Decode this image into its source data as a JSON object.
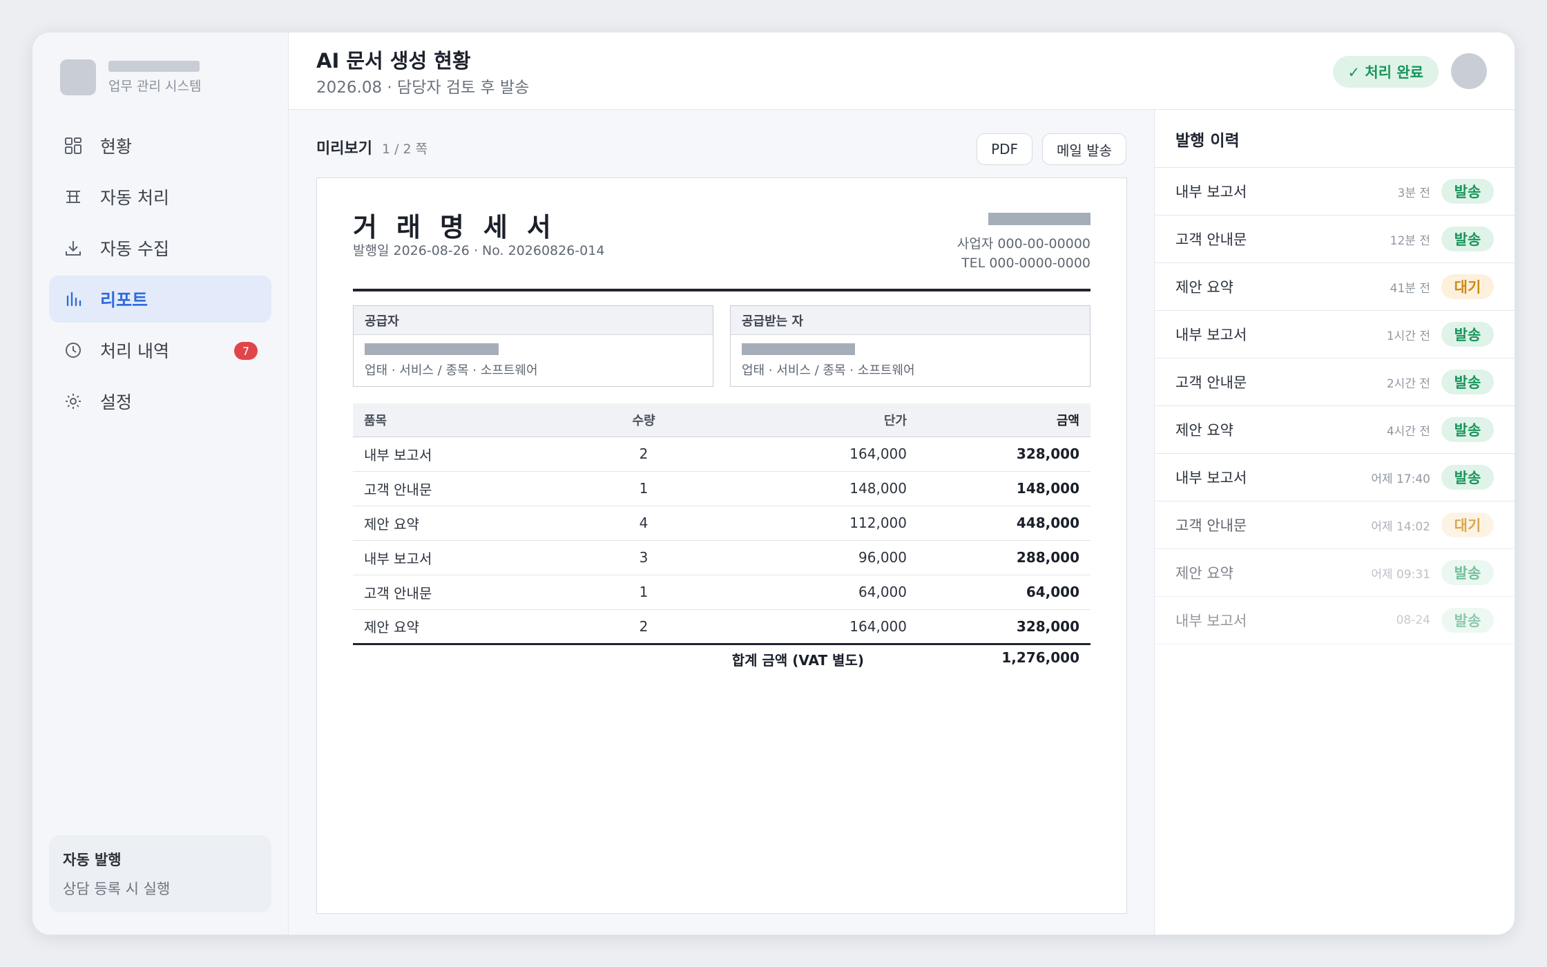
{
  "brand": {
    "subtitle": "업무 관리 시스템"
  },
  "nav": {
    "items": [
      {
        "label": "현황",
        "icon": "dashboard-grid-icon"
      },
      {
        "label": "자동 처리",
        "icon": "table-icon"
      },
      {
        "label": "자동 수집",
        "icon": "download-icon"
      },
      {
        "label": "리포트",
        "icon": "bar-chart-icon",
        "active": true
      },
      {
        "label": "처리 내역",
        "icon": "clock-icon",
        "badge": "7"
      },
      {
        "label": "설정",
        "icon": "gear-icon"
      }
    ]
  },
  "auto_card": {
    "title": "자동 발행",
    "subtitle": "상담 등록 시 실행"
  },
  "header": {
    "title": "AI 문서 생성 현황",
    "subtitle": "2026.08 · 담당자 검토 후 발송",
    "status": "✓ 처리 완료"
  },
  "preview": {
    "label": "미리보기",
    "page_info": "1 / 2 쪽",
    "pdf_button": "PDF",
    "mail_button": "메일 발송"
  },
  "document": {
    "title": "거래명세서",
    "meta": "발행일 2026-08-26 · No. 20260826-014",
    "biz_no": "사업자 000-00-00000",
    "tel": "TEL 000-0000-0000",
    "supplier": {
      "label": "공급자",
      "desc": "업태 · 서비스 / 종목 · 소프트웨어"
    },
    "receiver": {
      "label": "공급받는 자",
      "desc": "업태 · 서비스 / 종목 · 소프트웨어"
    },
    "columns": {
      "name": "품목",
      "qty": "수량",
      "price": "단가",
      "amount": "금액"
    },
    "rows": [
      {
        "name": "내부 보고서",
        "qty": "2",
        "price": "164,000",
        "amount": "328,000"
      },
      {
        "name": "고객 안내문",
        "qty": "1",
        "price": "148,000",
        "amount": "148,000"
      },
      {
        "name": "제안 요약",
        "qty": "4",
        "price": "112,000",
        "amount": "448,000"
      },
      {
        "name": "내부 보고서",
        "qty": "3",
        "price": "96,000",
        "amount": "288,000"
      },
      {
        "name": "고객 안내문",
        "qty": "1",
        "price": "64,000",
        "amount": "64,000"
      },
      {
        "name": "제안 요약",
        "qty": "2",
        "price": "164,000",
        "amount": "328,000"
      }
    ],
    "total_label": "합계 금액 (VAT 별도)",
    "total_value": "1,276,000"
  },
  "history": {
    "title": "발행 이력",
    "items": [
      {
        "name": "내부 보고서",
        "time": "3분 전",
        "status": "발송"
      },
      {
        "name": "고객 안내문",
        "time": "12분 전",
        "status": "발송"
      },
      {
        "name": "제안 요약",
        "time": "41분 전",
        "status": "대기"
      },
      {
        "name": "내부 보고서",
        "time": "1시간 전",
        "status": "발송"
      },
      {
        "name": "고객 안내문",
        "time": "2시간 전",
        "status": "발송"
      },
      {
        "name": "제안 요약",
        "time": "4시간 전",
        "status": "발송"
      },
      {
        "name": "내부 보고서",
        "time": "어제 17:40",
        "status": "발송"
      },
      {
        "name": "고객 안내문",
        "time": "어제 14:02",
        "status": "대기"
      },
      {
        "name": "제안 요약",
        "time": "어제 09:31",
        "status": "발송"
      },
      {
        "name": "내부 보고서",
        "time": "08-24",
        "status": "발송"
      }
    ]
  },
  "colors": {
    "accent": "#2f6bde",
    "success": "#16955a",
    "warning": "#cc8a12",
    "badge_red": "#e0454a"
  }
}
